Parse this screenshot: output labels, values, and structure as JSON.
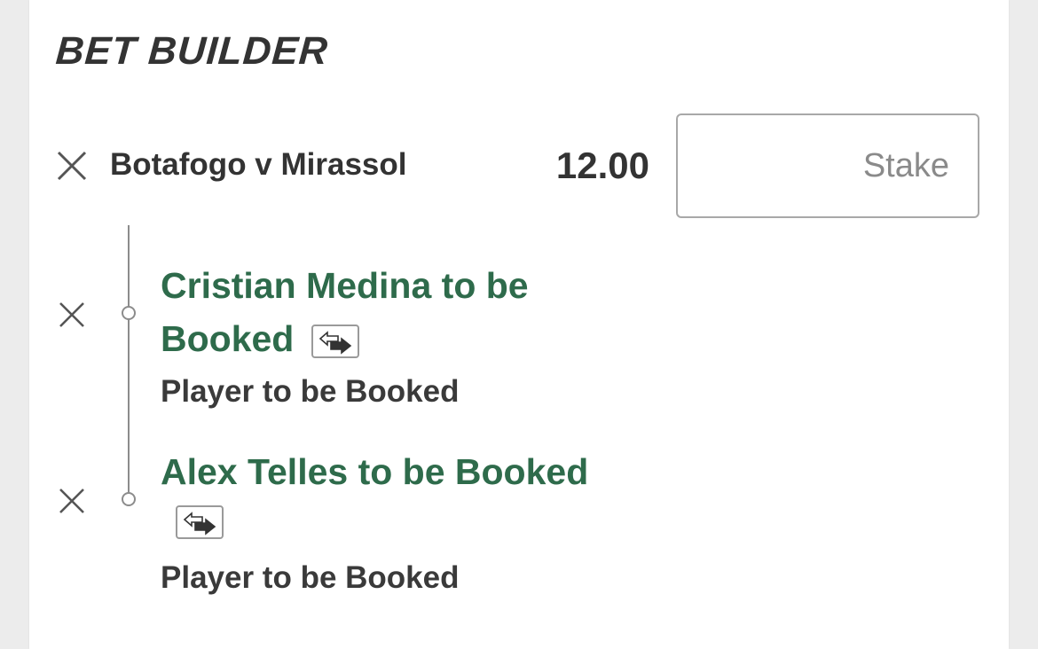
{
  "bet_builder": {
    "title": "BET BUILDER",
    "event": {
      "name": "Botafogo v Mirassol",
      "odds": "12.00",
      "stake_placeholder": "Stake",
      "stake_value": ""
    },
    "selections": [
      {
        "name": "Cristian Medina to be Booked",
        "market": "Player to be Booked",
        "icon": "swap-icon"
      },
      {
        "name": "Alex Telles to be Booked",
        "market": "Player to be Booked",
        "icon": "swap-icon"
      }
    ],
    "icons": {
      "remove": "close-icon",
      "leg_marker": "circle-node-icon"
    },
    "colors": {
      "selection_green": "#2e6b4b",
      "text_dark": "#333333",
      "border_grey": "#a8a8a8"
    }
  }
}
